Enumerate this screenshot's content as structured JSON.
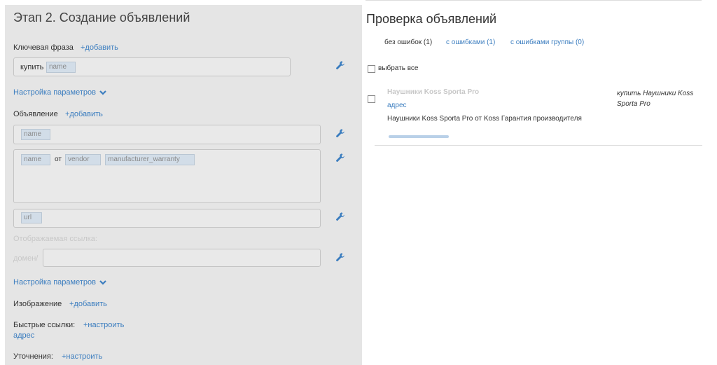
{
  "stage": {
    "title": "Этап 2. Создание объявлений",
    "keyphrase": {
      "label": "Ключевая фраза",
      "add": "+добавить",
      "prefix": "купить",
      "token": "name"
    },
    "params1": "Настройка параметров",
    "ad": {
      "label": "Объявление",
      "add": "+добавить",
      "title_token": "name",
      "text_tokens": [
        "name",
        "от",
        "vendor",
        "manufacturer_warranty"
      ],
      "url_token": "url",
      "display_link_label": "Отображаемая ссылка:",
      "domain_label": "домен/"
    },
    "params2": "Настройка параметров",
    "image": {
      "label": "Изображение",
      "add": "+добавить"
    },
    "quicklinks": {
      "label": "Быстрые ссылки:",
      "configure": "+настроить",
      "address": "адрес"
    },
    "clarifications": {
      "label": "Уточнения:",
      "configure": "+настроить"
    }
  },
  "check": {
    "title": "Проверка объявлений",
    "tabs": [
      {
        "label": "без ошибок (1)",
        "active": true
      },
      {
        "label": "с ошибками (1)",
        "active": false
      },
      {
        "label": "с ошибками группы (0)",
        "active": false
      }
    ],
    "select_all": "выбрать все",
    "ad": {
      "title": "Наушники Koss Sporta Pro",
      "address": "адрес",
      "text": "Наушники Koss Sporta Pro от Koss Гарантия производителя",
      "keyphrase": "купить Наушники Koss Sporta Pro"
    }
  },
  "colors": {
    "panel": "#e5e5e5",
    "link": "#3b7dbf",
    "token": "#d2dde8"
  }
}
